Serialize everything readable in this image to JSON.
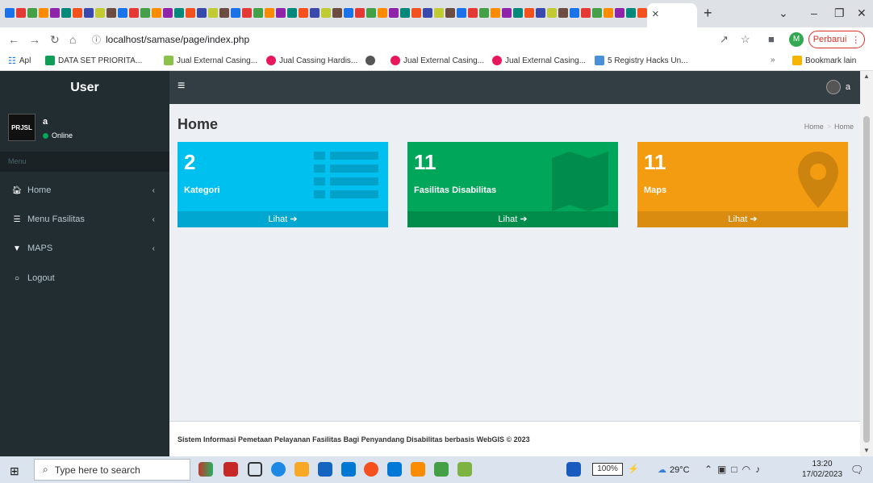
{
  "browser": {
    "tab_close": "×",
    "new_tab": "+",
    "url": "localhost/samase/page/index.php",
    "update_label": "Perbarui",
    "profile_initial": "M"
  },
  "bookmarks": [
    {
      "label": "Apl"
    },
    {
      "label": "DATA SET PRIORITA..."
    },
    {
      "label": "Jual External Casing..."
    },
    {
      "label": "Jual Cassing Hardis..."
    },
    {
      "label": "Jual External Casing..."
    },
    {
      "label": "Jual External Casing..."
    },
    {
      "label": "5 Registry Hacks Un..."
    },
    {
      "label": "Bookmark lain"
    }
  ],
  "site": {
    "brand": "User",
    "nav_username": "a",
    "user": {
      "name": "a",
      "status": "Online",
      "avatar_text": "PRJSL"
    },
    "menu_header": "Menu",
    "menu": [
      {
        "label": "Home",
        "icon": "home-icon"
      },
      {
        "label": "Menu Fasilitas",
        "icon": "list-icon"
      },
      {
        "label": "MAPS",
        "icon": "map-marker-icon"
      },
      {
        "label": "Logout",
        "icon": "circle-icon"
      }
    ],
    "page_title": "Home",
    "breadcrumb": [
      "Home",
      "Home"
    ],
    "boxes": [
      {
        "value": "2",
        "label": "Kategori",
        "link": "Lihat",
        "color": "#00c0ef",
        "icon": "list-icon"
      },
      {
        "value": "11",
        "label": "Fasilitas Disabilitas",
        "link": "Lihat",
        "color": "#00a65a",
        "icon": "map-icon"
      },
      {
        "value": "11",
        "label": "Maps",
        "link": "Lihat",
        "color": "#f39c12",
        "icon": "map-marker-icon"
      }
    ],
    "footer": "Sistem Informasi Pemetaan Pelayanan Fasilitas Bagi Penyandang Disabilitas berbasis WebGIS © 2023"
  },
  "taskbar": {
    "search_placeholder": "Type here to search",
    "battery": "100%",
    "temperature": "29°C",
    "time": "13:20",
    "date": "17/02/2023"
  }
}
